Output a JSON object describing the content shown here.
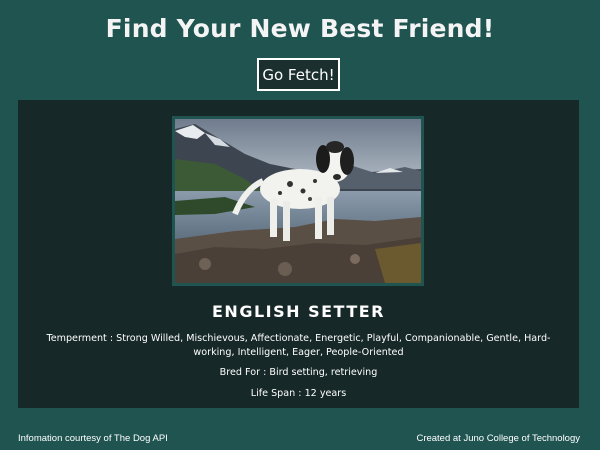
{
  "header": {
    "title": "Find Your New Best Friend!",
    "fetch_button_label": "Go Fetch!"
  },
  "dog": {
    "image_alt_semantic": "english-setter-photo",
    "breed_name": "ENGLISH SETTER",
    "temperament_label": "Temperment",
    "temperament_value": "Strong Willed, Mischievous, Affectionate, Energetic, Playful, Companionable, Gentle, Hard-working, Intelligent, Eager, People-Oriented",
    "bred_for_label": "Bred For",
    "bred_for_value": "Bird setting, retrieving",
    "life_span_label": "Life Span",
    "life_span_value": "12 years",
    "separator": " : "
  },
  "footer": {
    "left_text": "Infomation courtesy of The Dog API",
    "right_text": "Created at Juno College of Technology"
  },
  "colors": {
    "page_background": "#1f5451",
    "card_background": "#162827",
    "button_background": "#1b2f2e",
    "text": "#ffffff"
  }
}
